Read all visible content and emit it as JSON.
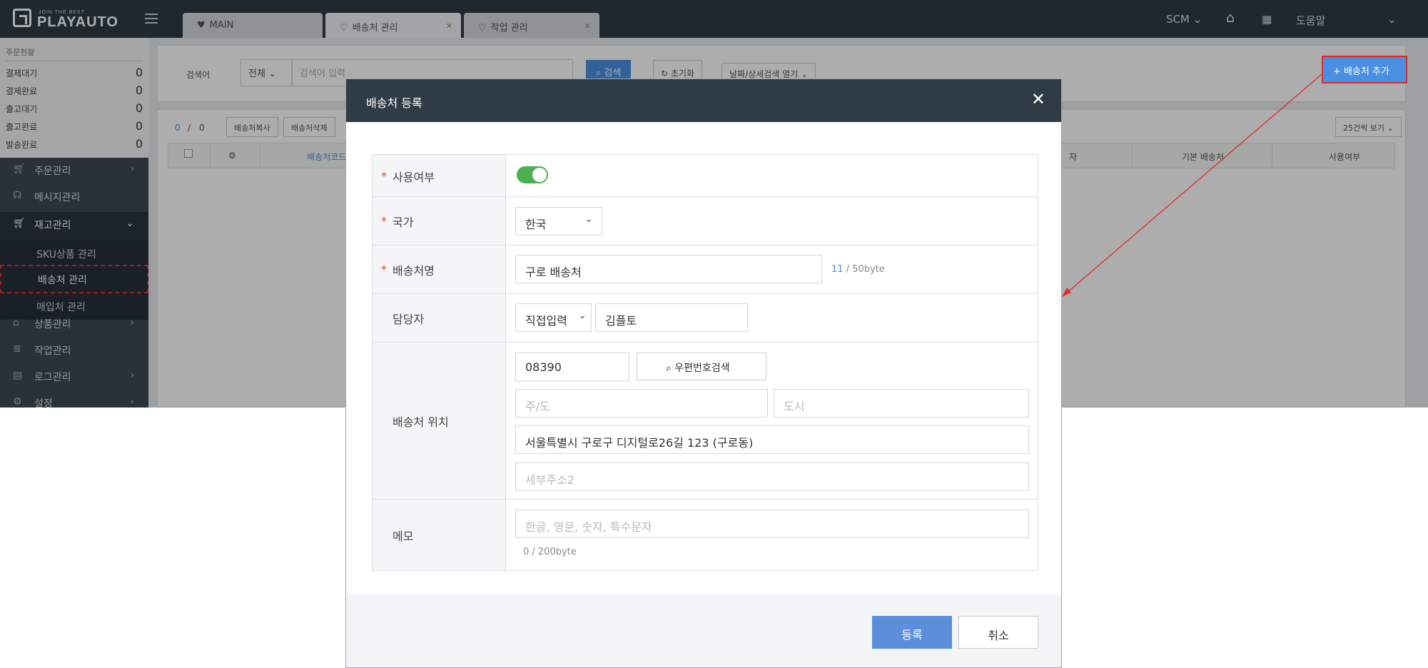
{
  "topbar": {
    "logo_tagline": "JOIN THE BEST",
    "logo_name": "PLAYAUTO",
    "tabs": [
      {
        "label": "MAIN",
        "closable": false
      },
      {
        "label": "배송처 관리",
        "closable": true
      },
      {
        "label": "작업 관리",
        "closable": true
      }
    ],
    "scm_label": "SCM",
    "help_label": "도움말"
  },
  "sidebar": {
    "stats_title": "주문현황",
    "stats": [
      {
        "label": "결제대기",
        "value": "0"
      },
      {
        "label": "결제완료",
        "value": "0"
      },
      {
        "label": "출고대기",
        "value": "0"
      },
      {
        "label": "출고완료",
        "value": "0"
      },
      {
        "label": "발송완료",
        "value": "0"
      }
    ],
    "menu": [
      {
        "label": "주문관리"
      },
      {
        "label": "메시지관리"
      },
      {
        "label": "재고관리"
      },
      {
        "label": "상품관리"
      },
      {
        "label": "작업관리"
      },
      {
        "label": "로그관리"
      },
      {
        "label": "설정"
      }
    ],
    "submenu": [
      {
        "label": "SKU상품 관리"
      },
      {
        "label": "배송처 관리"
      },
      {
        "label": "매입처 관리"
      }
    ]
  },
  "search": {
    "label": "검색어",
    "scope_value": "전체",
    "keyword_placeholder": "검색어 입력",
    "search_button": "검색",
    "reset_button": "초기화",
    "detail_button": "날짜/상세검색 열기",
    "add_button": "배송처 추가"
  },
  "list": {
    "count_current": "0",
    "count_sep": "/",
    "count_total": "0",
    "copy_button": "배송처복사",
    "delete_button": "배송처삭제",
    "page_size": "25건씩 보기",
    "columns": [
      "배송처코드",
      "자",
      "기본 배송처",
      "사용여부"
    ]
  },
  "modal": {
    "title": "배송처 등록",
    "fields": {
      "use_label": "사용여부",
      "use_value": true,
      "country_label": "국가",
      "country_value": "한국",
      "name_label": "배송처명",
      "name_value": "구로 배송처",
      "name_count": "11",
      "name_limit": " / 50byte",
      "manager_label": "담당자",
      "manager_mode": "직접입력",
      "manager_value": "김플토",
      "location_label": "배송처 위치",
      "zip_value": "08390",
      "zip_button": "우편번호검색",
      "state_placeholder": "주/도",
      "city_placeholder": "도시",
      "address1_value": "서울특별시 구로구 디지털로26길 123 (구로동)",
      "address2_placeholder": "세부주소2",
      "memo_label": "메모",
      "memo_placeholder": "한글, 영문, 숫자, 특수문자",
      "memo_count": "0 / 200byte"
    },
    "submit_button": "등록",
    "cancel_button": "취소"
  },
  "colors": {
    "topbar": "#2f3b46",
    "primary": "#4a90e2",
    "toggle_on": "#4caf50",
    "highlight_red": "#e02b2b"
  }
}
